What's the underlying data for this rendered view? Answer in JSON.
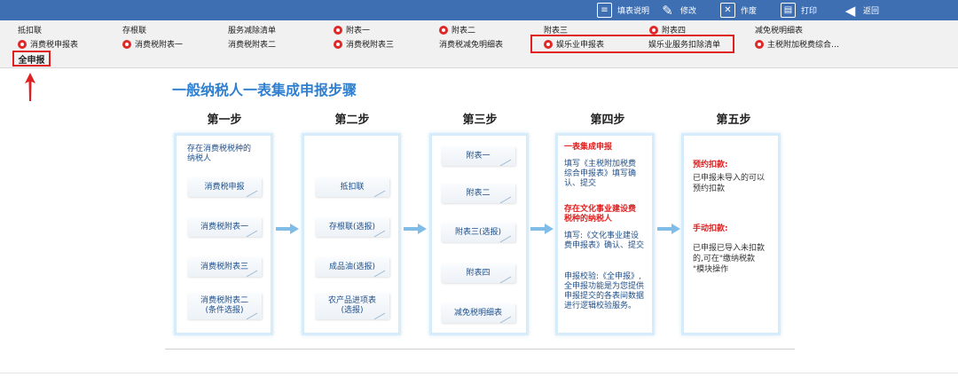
{
  "toolbar": {
    "fill_help": "填表说明",
    "edit": "修改",
    "void": "作废",
    "print": "打印",
    "back": "返回"
  },
  "menu": {
    "row1": [
      "抵扣联",
      "存根联",
      "服务减除清单",
      "附表一",
      "附表二",
      "附表三",
      "附表四",
      "减免税明细表"
    ],
    "row2": [
      "消费税申报表",
      "消费税附表一",
      "消费税附表二",
      "消费税附表三",
      "消费税减免明细表",
      "娱乐业申报表",
      "娱乐业服务扣除清单",
      "主税附加税费综合…"
    ],
    "full_declare": "全申报"
  },
  "diagram": {
    "title": "一般纳税人一表集成申报步骤",
    "steps": [
      "第一步",
      "第二步",
      "第三步",
      "第四步",
      "第五步"
    ],
    "step1": {
      "header_line1": "存在消费税税种的",
      "header_line2": "纳税人",
      "items": [
        "消费税申报",
        "消费税附表一",
        "消费税附表三",
        "消费税附表二",
        "(条件选报)"
      ]
    },
    "step2": {
      "items": [
        "抵扣联",
        "存根联(选报)",
        "成品油(选报)",
        "农产品进项表",
        "(选报)"
      ]
    },
    "step3": {
      "items": [
        "附表一",
        "附表二",
        "附表三(选报)",
        "附表四",
        "减免税明细表"
      ]
    },
    "step4": {
      "h1": "一表集成申报",
      "t1": [
        "填写《主税附加税费",
        "综合申报表》填写确",
        "认、提交"
      ],
      "h2": [
        "存在文化事业建设费",
        "税种的纳税人"
      ],
      "t2": [
        "填写:《文化事业建设",
        "费申报表》确认、提交"
      ],
      "t3": [
        "申报校验:《全申报》,",
        "全申报功能是为您提供",
        "申报提交的各表间数据",
        "进行逻辑校验服务。"
      ]
    },
    "step5": {
      "h1": "预约扣款:",
      "t1": [
        "已申报未导入的可以",
        "预约扣款"
      ],
      "h2": "手动扣款:",
      "t2": [
        "已申报已导入未扣款",
        "的,可在\"缴纳税款",
        "\"模块操作"
      ]
    }
  },
  "colors": {
    "toolbar": "#3e6fb3",
    "accent_red": "#e02020",
    "title_blue": "#2e7fd0",
    "panel_border": "#d6ecfa"
  }
}
